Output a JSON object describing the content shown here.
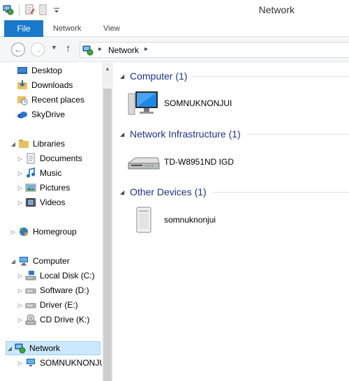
{
  "window": {
    "title": "Network"
  },
  "ribbon": {
    "file": "File",
    "tabs": [
      "Network",
      "View"
    ]
  },
  "address": {
    "crumb": "Network"
  },
  "nav": {
    "favorites": [
      "Desktop",
      "Downloads",
      "Recent places",
      "SkyDrive"
    ],
    "libraries": {
      "label": "Libraries",
      "items": [
        "Documents",
        "Music",
        "Pictures",
        "Videos"
      ]
    },
    "homegroup": "Homegroup",
    "computer": {
      "label": "Computer",
      "items": [
        "Local Disk (C:)",
        "Software (D:)",
        "Driver (E:)",
        "CD Drive (K:)"
      ]
    },
    "network": {
      "label": "Network",
      "items": [
        "SOMNUKNONJUI"
      ]
    }
  },
  "content": {
    "groups": [
      {
        "title": "Computer (1)",
        "items": [
          "SOMNUKNONJUI"
        ]
      },
      {
        "title": "Network Infrastructure (1)",
        "items": [
          "TD-W8951ND IGD"
        ]
      },
      {
        "title": "Other Devices (1)",
        "items": [
          "somnuknonjui"
        ]
      }
    ]
  },
  "colors": {
    "accent": "#1979ca",
    "selection": "#cce8ff",
    "group_title": "#1e3287"
  }
}
